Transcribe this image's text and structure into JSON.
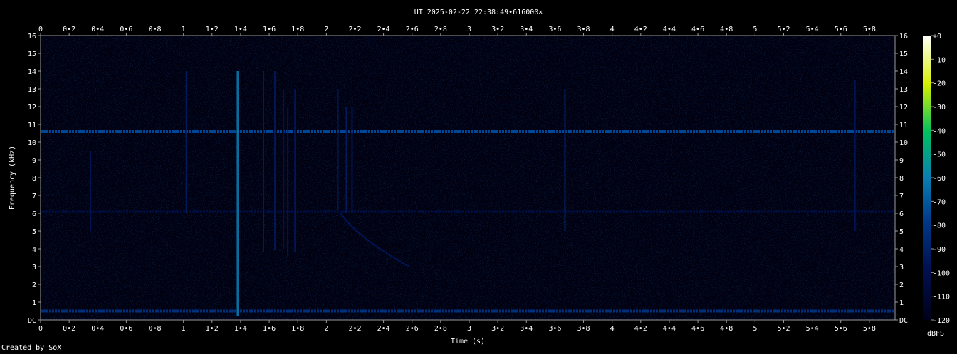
{
  "chart_data": {
    "type": "heatmap",
    "title": "UT 2025-02-22 22:38:49•616000×",
    "xlabel": "Time (s)",
    "ylabel": "Frequency (kHz)",
    "xlim": [
      0,
      5.98
    ],
    "ylim": [
      0,
      16
    ],
    "x_ticks": [
      0,
      0.2,
      0.4,
      0.6,
      0.8,
      1,
      1.2,
      1.4,
      1.6,
      1.8,
      2,
      2.2,
      2.4,
      2.6,
      2.8,
      3,
      3.2,
      3.4,
      3.6,
      3.8,
      4,
      4.2,
      4.4,
      4.6,
      4.8,
      5,
      5.2,
      5.4,
      5.6,
      5.8
    ],
    "x_tick_labels": [
      "0",
      "0•2",
      "0•4",
      "0•6",
      "0•8",
      "1",
      "1•2",
      "1•4",
      "1•6",
      "1•8",
      "2",
      "2•2",
      "2•4",
      "2•6",
      "2•8",
      "3",
      "3•2",
      "3•4",
      "3•6",
      "3•8",
      "4",
      "4•2",
      "4•4",
      "4•6",
      "4•8",
      "5",
      "5•2",
      "5•4",
      "5•6",
      "5•8"
    ],
    "y_ticks": [
      0,
      1,
      2,
      3,
      4,
      5,
      6,
      7,
      8,
      9,
      10,
      11,
      12,
      13,
      14,
      15,
      16
    ],
    "y_tick_labels": [
      "DC",
      "1",
      "2",
      "3",
      "4",
      "5",
      "6",
      "7",
      "8",
      "9",
      "10",
      "11",
      "12",
      "13",
      "14",
      "15",
      "16"
    ],
    "colorbar": {
      "label": "dBFS",
      "range": [
        -120,
        0
      ],
      "ticks": [
        0,
        -10,
        -20,
        -30,
        -40,
        -50,
        -60,
        -70,
        -80,
        -90,
        -100,
        -110,
        -120
      ],
      "tick_labels": [
        "+0",
        "-10",
        "-20",
        "-30",
        "-40",
        "-50",
        "-60",
        "-70",
        "-80",
        "-90",
        "-100",
        "-110",
        "-120"
      ],
      "colors": [
        "#00001a",
        "#001050",
        "#003a8a",
        "#0a7fb0",
        "#00c060",
        "#d8f000",
        "#ffffff"
      ]
    },
    "tones": [
      {
        "freq_khz": 10.6,
        "level_dbfs": -80
      },
      {
        "freq_khz": 0.5,
        "level_dbfs": -88
      },
      {
        "freq_khz": 6.1,
        "level_dbfs": -103
      }
    ],
    "transients": [
      {
        "time_s": 0.35,
        "f_low_khz": 5.0,
        "f_high_khz": 9.5,
        "level_dbfs": -98
      },
      {
        "time_s": 1.02,
        "f_low_khz": 6.0,
        "f_high_khz": 14.0,
        "level_dbfs": -95
      },
      {
        "time_s": 1.38,
        "f_low_khz": 0.2,
        "f_high_khz": 14.0,
        "level_dbfs": -62
      },
      {
        "time_s": 1.56,
        "f_low_khz": 3.8,
        "f_high_khz": 14.0,
        "level_dbfs": -95
      },
      {
        "time_s": 1.64,
        "f_low_khz": 3.9,
        "f_high_khz": 14.0,
        "level_dbfs": -96
      },
      {
        "time_s": 1.7,
        "f_low_khz": 4.0,
        "f_high_khz": 13.0,
        "level_dbfs": -98
      },
      {
        "time_s": 1.73,
        "f_low_khz": 3.6,
        "f_high_khz": 12.0,
        "level_dbfs": -97
      },
      {
        "time_s": 1.78,
        "f_low_khz": 3.8,
        "f_high_khz": 13.0,
        "level_dbfs": -97
      },
      {
        "time_s": 2.08,
        "f_low_khz": 6.2,
        "f_high_khz": 13.0,
        "level_dbfs": -93
      },
      {
        "time_s": 2.14,
        "f_low_khz": 6.0,
        "f_high_khz": 12.0,
        "level_dbfs": -95
      },
      {
        "time_s": 2.18,
        "f_low_khz": 6.0,
        "f_high_khz": 12.0,
        "level_dbfs": -96
      },
      {
        "time_s": 3.67,
        "f_low_khz": 5.0,
        "f_high_khz": 13.0,
        "level_dbfs": -92
      },
      {
        "time_s": 5.7,
        "f_low_khz": 5.0,
        "f_high_khz": 13.5,
        "level_dbfs": -98
      }
    ],
    "sweep": {
      "t_start_s": 2.1,
      "t_end_s": 2.58,
      "f_start_khz": 6.0,
      "f_end_khz": 3.0,
      "level_dbfs": -98
    },
    "grid": false,
    "legend": "colorbar right"
  },
  "footer": {
    "credit": "Created by SoX"
  }
}
